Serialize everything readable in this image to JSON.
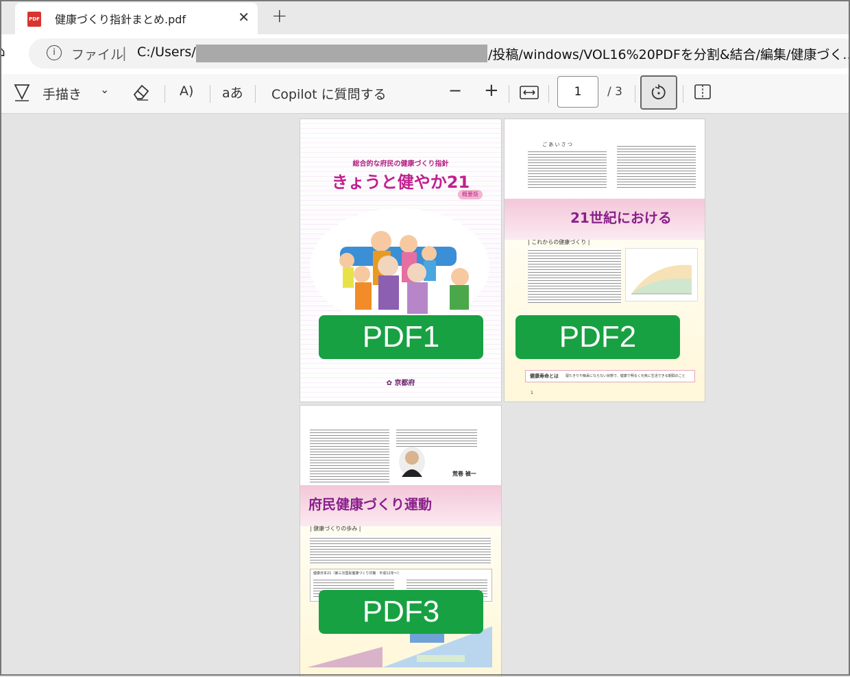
{
  "tab": {
    "title": "健康づくり指針まとめ.pdf",
    "close": "✕",
    "icon_label": "PDF"
  },
  "new_tab": "+",
  "address": {
    "file_label": "ファイル",
    "url_prefix": "C:/Users/",
    "url_suffix": "/投稿/windows/VOL16%20PDFを分割&結合/編集/健康づく..."
  },
  "toolbar": {
    "draw_label": "手描き",
    "copilot_label": "Copilot に質問する",
    "read_aloud_icon": "A)",
    "text_icon": "aあ",
    "page_number": "1",
    "page_total": "/ 3"
  },
  "pages": [
    {
      "label": "PDF1",
      "subtitle": "総合的な府民の健康づくり指針",
      "title": "きょうと健やか21",
      "tag": "概要版",
      "org": "京都府"
    },
    {
      "label": "PDF2",
      "greeting": "ご あ い さ つ",
      "heading": "21世紀における",
      "section": "これからの健康づくり",
      "footer_title": "健康寿命とは",
      "footer_text": "寝たきりや痴呆にならない状態で、健康で明るく元気に生活できる期間のこと",
      "page_no": "1"
    },
    {
      "label": "PDF3",
      "heading": "府民健康づくり運動",
      "section": "健康づくりの歩み",
      "box_title": "健康日本21（第三次国民健康づくり対策　平成12年〜）",
      "signer": "荒巻 禎一"
    }
  ]
}
